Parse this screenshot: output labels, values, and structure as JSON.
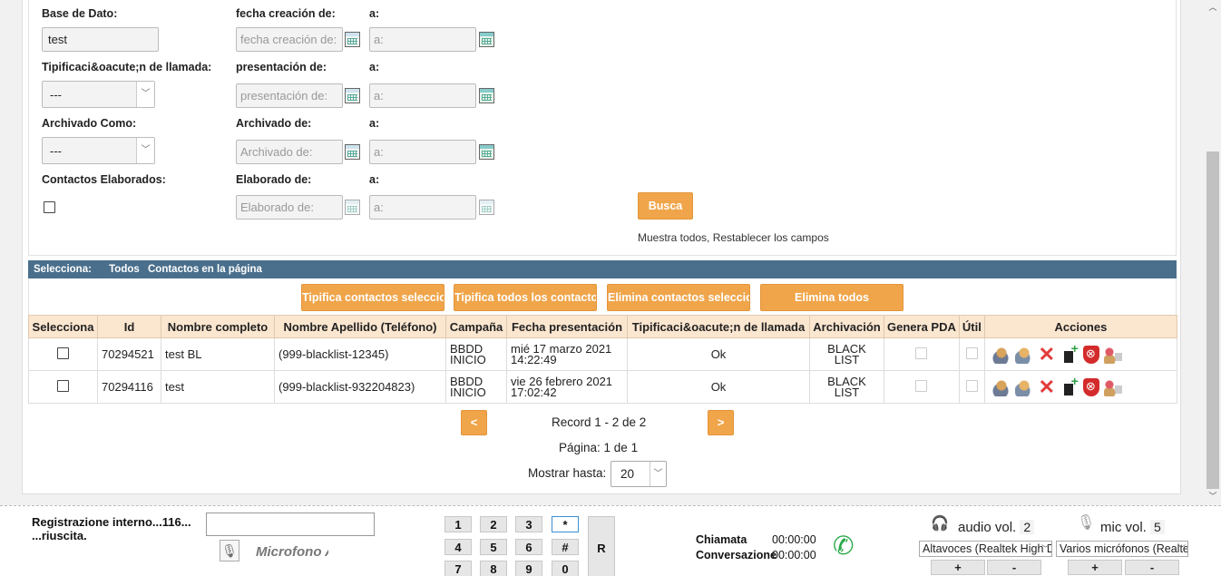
{
  "filters": {
    "base_dato_label": "Base de Dato:",
    "base_dato_value": "test",
    "fecha_creacion_label": "fecha creación de:",
    "fecha_creacion_placeholder": "fecha creación de:",
    "a_label": "a:",
    "a_placeholder": "a:",
    "tipificacion_label": "Tipificaci&oacute;n de llamada:",
    "tipificacion_value": "---",
    "presentacion_label": "presentación de:",
    "presentacion_placeholder": "presentación de:",
    "archivado_como_label": "Archivado Como:",
    "archivado_como_value": "---",
    "archivado_label": "Archivado de:",
    "archivado_placeholder": "Archivado de:",
    "elaborados_label": "Contactos Elaborados:",
    "elaborado_label": "Elaborado de:",
    "elaborado_placeholder": "Elaborado de:",
    "busca_button": "Busca",
    "muestra_link": "Muestra todos, Restablecer los campos"
  },
  "selection_bar": {
    "label": "Selecciona:",
    "todos": "Todos",
    "contactos": "Contactos en la página"
  },
  "bulk_actions": {
    "tipifica_seleccionados": "Tipifica contactos seleccionados",
    "tipifica_todos": "Tipifica todos los contactos",
    "elimina_seleccionados": "Elimina contactos seleccionados",
    "elimina_todos": "Elimina todos"
  },
  "table": {
    "headers": [
      "Selecciona",
      "Id",
      "Nombre completo",
      "Nombre Apellido (Teléfono)",
      "Campaña",
      "Fecha presentación",
      "Tipificaci&oacute;n de llamada",
      "Archivación",
      "Genera PDA",
      "Útil",
      "Acciones"
    ],
    "rows": [
      {
        "id": "70294521",
        "nombre": "test BL",
        "telefono": "(999-blacklist-12345)",
        "campana_1": "BBDD",
        "campana_2": "INICIO",
        "fecha_1": "mié 17 marzo 2021",
        "fecha_2": "14:22:49",
        "tipificacion": "Ok",
        "archivacion_1": "BLACK",
        "archivacion_2": "LIST"
      },
      {
        "id": "70294116",
        "nombre": "test",
        "telefono": "(999-blacklist-932204823)",
        "campana_1": "BBDD",
        "campana_2": "INICIO",
        "fecha_1": "vie 26 febrero 2021",
        "fecha_2": "17:02:42",
        "tipificacion": "Ok",
        "archivacion_1": "BLACK",
        "archivacion_2": "LIST"
      }
    ]
  },
  "pager": {
    "prev": "<",
    "next": ">",
    "record_text": "Record 1 - 2 de 2",
    "pagina_text": "Página: 1 de 1",
    "mostrar_label": "Mostrar hasta:",
    "mostrar_value": "20"
  },
  "phonebar": {
    "reg_line1": "Registrazione interno...116...",
    "reg_line2": "...riuscita.",
    "mic_status": "Microfono Attivo",
    "keys": [
      "1",
      "2",
      "3",
      "*",
      "4",
      "5",
      "6",
      "#",
      "7",
      "8",
      "9",
      "0"
    ],
    "r_key": "R",
    "chiamata_label": "Chiamata",
    "chiamata_time": "00:00:00",
    "conversazione_label": "Conversazione",
    "conversazione_time": "00:00:00",
    "audio_label": "audio vol.",
    "audio_value": "2",
    "mic_label": "mic vol.",
    "mic_value": "5",
    "audio_device": "Altavoces (Realtek High Definition Audio)",
    "mic_device": "Varios micrófonos (Realtek)",
    "plus": "+",
    "minus": "-"
  },
  "colors": {
    "accent_orange": "#f0a54a",
    "selection_bar": "#4a6f8c",
    "table_header": "#fbe6d0"
  }
}
